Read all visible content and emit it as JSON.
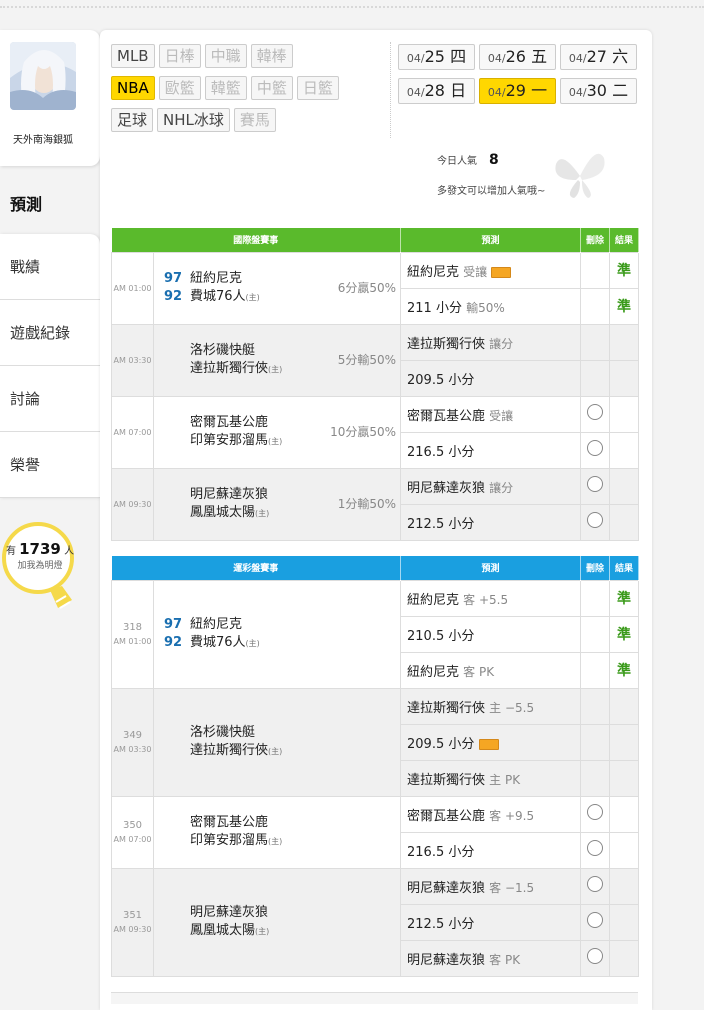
{
  "profile": {
    "name": "天外南海銀狐"
  },
  "nav": {
    "active": "預測",
    "items": [
      "戰績",
      "遊戲紀錄",
      "討論",
      "榮譽"
    ]
  },
  "fans": {
    "prefix": "有",
    "count": "1739",
    "suffix": "人",
    "sub": "加我為明燈"
  },
  "tags": [
    [
      {
        "label": "MLB",
        "state": "normal"
      },
      {
        "label": "日棒",
        "state": "dim"
      },
      {
        "label": "中職",
        "state": "dim"
      },
      {
        "label": "韓棒",
        "state": "dim"
      }
    ],
    [
      {
        "label": "NBA",
        "state": "on"
      },
      {
        "label": "歐籃",
        "state": "dim"
      },
      {
        "label": "韓籃",
        "state": "dim"
      },
      {
        "label": "中籃",
        "state": "dim"
      },
      {
        "label": "日籃",
        "state": "dim"
      }
    ],
    [
      {
        "label": "足球",
        "state": "normal"
      },
      {
        "label": "NHL冰球",
        "state": "normal"
      },
      {
        "label": "賽馬",
        "state": "dim"
      }
    ]
  ],
  "dates": [
    [
      {
        "md": "04/",
        "d": "25",
        "w": "四",
        "on": false
      },
      {
        "md": "04/",
        "d": "26",
        "w": "五",
        "on": false
      },
      {
        "md": "04/",
        "d": "27",
        "w": "六",
        "on": false
      }
    ],
    [
      {
        "md": "04/",
        "d": "28",
        "w": "日",
        "on": false
      },
      {
        "md": "04/",
        "d": "29",
        "w": "一",
        "on": true
      },
      {
        "md": "04/",
        "d": "30",
        "w": "二",
        "on": false
      }
    ]
  ],
  "popularity": {
    "label": "今日人氣",
    "value": "8",
    "hint": "多發文可以增加人氣哦~"
  },
  "intl": {
    "headers": {
      "event": "國際盤賽事",
      "pred": "預測",
      "del": "刪除",
      "result": "結果"
    },
    "rows": [
      {
        "time": "AM 01:00",
        "away": "紐約尼克",
        "home": "費城76人",
        "home_mark": "(主)",
        "away_score": "97",
        "home_score": "92",
        "odds": "6分贏50%",
        "gray": false,
        "preds": [
          {
            "main": "紐約尼克",
            "light": "受讓",
            "badge": true,
            "result": "準",
            "circle": false
          },
          {
            "main": "211 小分",
            "light": "輸50%",
            "badge": false,
            "result": "準",
            "circle": false
          }
        ]
      },
      {
        "time": "AM 03:30",
        "away": "洛杉磯快艇",
        "home": "達拉斯獨行俠",
        "home_mark": "(主)",
        "away_score": "",
        "home_score": "",
        "odds": "5分輸50%",
        "gray": true,
        "preds": [
          {
            "main": "達拉斯獨行俠",
            "light": "讓分",
            "badge": false,
            "result": "",
            "circle": false
          },
          {
            "main": "209.5 小分",
            "light": "",
            "badge": false,
            "result": "",
            "circle": false
          }
        ]
      },
      {
        "time": "AM 07:00",
        "away": "密爾瓦基公鹿",
        "home": "印第安那溜馬",
        "home_mark": "(主)",
        "away_score": "",
        "home_score": "",
        "odds": "10分贏50%",
        "gray": false,
        "preds": [
          {
            "main": "密爾瓦基公鹿",
            "light": "受讓",
            "badge": false,
            "result": "",
            "circle": true
          },
          {
            "main": "216.5 小分",
            "light": "",
            "badge": false,
            "result": "",
            "circle": true
          }
        ]
      },
      {
        "time": "AM 09:30",
        "away": "明尼蘇達灰狼",
        "home": "鳳凰城太陽",
        "home_mark": "(主)",
        "away_score": "",
        "home_score": "",
        "odds": "1分輸50%",
        "gray": true,
        "preds": [
          {
            "main": "明尼蘇達灰狼",
            "light": "讓分",
            "badge": false,
            "result": "",
            "circle": true
          },
          {
            "main": "212.5 小分",
            "light": "",
            "badge": false,
            "result": "",
            "circle": true
          }
        ]
      }
    ]
  },
  "lottery": {
    "headers": {
      "event": "運彩盤賽事",
      "pred": "預測",
      "del": "刪除",
      "result": "結果"
    },
    "rows": [
      {
        "no": "318",
        "time": "AM 01:00",
        "away": "紐約尼克",
        "home": "費城76人",
        "home_mark": "(主)",
        "away_score": "97",
        "home_score": "92",
        "gray": false,
        "preds": [
          {
            "main": "紐約尼克",
            "light": "客 +5.5",
            "badge": false,
            "result": "準",
            "circle": false
          },
          {
            "main": "210.5 小分",
            "light": "",
            "badge": false,
            "result": "準",
            "circle": false
          },
          {
            "main": "紐約尼克",
            "light": "客 PK",
            "badge": false,
            "result": "準",
            "circle": false
          }
        ]
      },
      {
        "no": "349",
        "time": "AM 03:30",
        "away": "洛杉磯快艇",
        "home": "達拉斯獨行俠",
        "home_mark": "(主)",
        "away_score": "",
        "home_score": "",
        "gray": true,
        "preds": [
          {
            "main": "達拉斯獨行俠",
            "light": "主 −5.5",
            "badge": false,
            "result": "",
            "circle": false
          },
          {
            "main": "209.5 小分",
            "light": "",
            "badge": true,
            "result": "",
            "circle": false
          },
          {
            "main": "達拉斯獨行俠",
            "light": "主 PK",
            "badge": false,
            "result": "",
            "circle": false
          }
        ]
      },
      {
        "no": "350",
        "time": "AM 07:00",
        "away": "密爾瓦基公鹿",
        "home": "印第安那溜馬",
        "home_mark": "(主)",
        "away_score": "",
        "home_score": "",
        "gray": false,
        "preds": [
          {
            "main": "密爾瓦基公鹿",
            "light": "客 +9.5",
            "badge": false,
            "result": "",
            "circle": true
          },
          {
            "main": "216.5 小分",
            "light": "",
            "badge": false,
            "result": "",
            "circle": true
          }
        ]
      },
      {
        "no": "351",
        "time": "AM 09:30",
        "away": "明尼蘇達灰狼",
        "home": "鳳凰城太陽",
        "home_mark": "(主)",
        "away_score": "",
        "home_score": "",
        "gray": true,
        "preds": [
          {
            "main": "明尼蘇達灰狼",
            "light": "客 −1.5",
            "badge": false,
            "result": "",
            "circle": true
          },
          {
            "main": "212.5 小分",
            "light": "",
            "badge": false,
            "result": "",
            "circle": true
          },
          {
            "main": "明尼蘇達灰狼",
            "light": "客 PK",
            "badge": false,
            "result": "",
            "circle": true
          }
        ]
      }
    ]
  }
}
